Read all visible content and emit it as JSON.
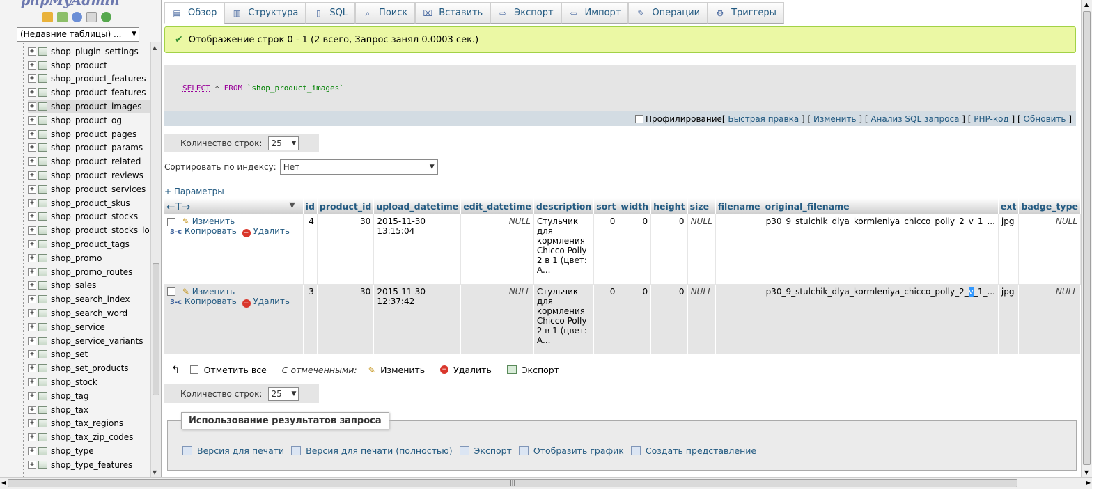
{
  "nav": {
    "logo": "phpMyAdmin",
    "recent_tables": "(Недавние таблицы) ...",
    "tables": [
      {
        "name": "shop_plugin_settings",
        "selected": false
      },
      {
        "name": "shop_product",
        "selected": false
      },
      {
        "name": "shop_product_features",
        "selected": false
      },
      {
        "name": "shop_product_features_",
        "selected": false
      },
      {
        "name": "shop_product_images",
        "selected": true
      },
      {
        "name": "shop_product_og",
        "selected": false
      },
      {
        "name": "shop_product_pages",
        "selected": false
      },
      {
        "name": "shop_product_params",
        "selected": false
      },
      {
        "name": "shop_product_related",
        "selected": false
      },
      {
        "name": "shop_product_reviews",
        "selected": false
      },
      {
        "name": "shop_product_services",
        "selected": false
      },
      {
        "name": "shop_product_skus",
        "selected": false
      },
      {
        "name": "shop_product_stocks",
        "selected": false
      },
      {
        "name": "shop_product_stocks_lo",
        "selected": false
      },
      {
        "name": "shop_product_tags",
        "selected": false
      },
      {
        "name": "shop_promo",
        "selected": false
      },
      {
        "name": "shop_promo_routes",
        "selected": false
      },
      {
        "name": "shop_sales",
        "selected": false
      },
      {
        "name": "shop_search_index",
        "selected": false
      },
      {
        "name": "shop_search_word",
        "selected": false
      },
      {
        "name": "shop_service",
        "selected": false
      },
      {
        "name": "shop_service_variants",
        "selected": false
      },
      {
        "name": "shop_set",
        "selected": false
      },
      {
        "name": "shop_set_products",
        "selected": false
      },
      {
        "name": "shop_stock",
        "selected": false
      },
      {
        "name": "shop_tag",
        "selected": false
      },
      {
        "name": "shop_tax",
        "selected": false
      },
      {
        "name": "shop_tax_regions",
        "selected": false
      },
      {
        "name": "shop_tax_zip_codes",
        "selected": false
      },
      {
        "name": "shop_type",
        "selected": false
      },
      {
        "name": "shop_type_features",
        "selected": false
      }
    ]
  },
  "tabs": [
    {
      "label": "Обзор",
      "icon": "browse-icon",
      "glyph": "▤",
      "active": true
    },
    {
      "label": "Структура",
      "icon": "structure-icon",
      "glyph": "▥",
      "active": false
    },
    {
      "label": "SQL",
      "icon": "sql-icon",
      "glyph": "▯",
      "active": false
    },
    {
      "label": "Поиск",
      "icon": "search-icon",
      "glyph": "⌕",
      "active": false
    },
    {
      "label": "Вставить",
      "icon": "insert-icon",
      "glyph": "⌧",
      "active": false
    },
    {
      "label": "Экспорт",
      "icon": "export-icon",
      "glyph": "⇨",
      "active": false
    },
    {
      "label": "Импорт",
      "icon": "import-icon",
      "glyph": "⇦",
      "active": false
    },
    {
      "label": "Операции",
      "icon": "operations-icon",
      "glyph": "✎",
      "active": false
    },
    {
      "label": "Триггеры",
      "icon": "triggers-icon",
      "glyph": "⚙",
      "active": false
    }
  ],
  "message": "Отображение строк 0 - 1 (2 всего, Запрос занял 0.0003 сек.)",
  "sql": {
    "kw_select": "SELECT",
    "star": " * ",
    "kw_from": "FROM",
    "table": " `shop_product_images`"
  },
  "sqlbar": {
    "profiling": "Профилирование",
    "links": [
      "Быстрая правка",
      "Изменить",
      "Анализ SQL запроса",
      "PHP-код",
      "Обновить"
    ]
  },
  "rows_count": {
    "label": "Количество строк:",
    "value": "25"
  },
  "sort": {
    "label": "Сортировать по индексу:",
    "value": "Нет"
  },
  "params_link": "+ Параметры",
  "table": {
    "arrows": "←T→",
    "columns": [
      "id",
      "product_id",
      "upload_datetime",
      "edit_datetime",
      "description",
      "sort",
      "width",
      "height",
      "size",
      "filename",
      "original_filename",
      "ext",
      "badge_type"
    ],
    "actions": {
      "edit": "Изменить",
      "copy": "Копировать",
      "delete": "Удалить"
    },
    "rows": [
      {
        "id": "4",
        "product_id": "30",
        "upload_datetime": "2015-11-30 13:15:04",
        "edit_datetime": "NULL",
        "description": "Стульчик для кормления Chicco Polly 2 в 1 (цвет: А...",
        "sort": "0",
        "width": "0",
        "height": "0",
        "size": "NULL",
        "filename": "",
        "original_filename": "p30_9_stulchik_dlya_kormleniya_chicco_polly_2_v_1_...",
        "ext": "jpg",
        "badge_type": "NULL"
      },
      {
        "id": "3",
        "product_id": "30",
        "upload_datetime": "2015-11-30 12:37:42",
        "edit_datetime": "NULL",
        "description": "Стульчик для кормления Chicco Polly 2 в 1 (цвет: А...",
        "sort": "0",
        "width": "0",
        "height": "0",
        "size": "NULL",
        "filename": "",
        "of_pre": "p30_9_stulchik_dlya_kormleniya_chicco_polly_2_",
        "of_hl": "v",
        "of_post": "_1_...",
        "ext": "jpg",
        "badge_type": "NULL"
      }
    ]
  },
  "with_selected": {
    "check_all": "Отметить все",
    "label": "С отмеченными:",
    "edit": "Изменить",
    "delete": "Удалить",
    "export": "Экспорт"
  },
  "query_results": {
    "legend": "Использование результатов запроса",
    "links": [
      {
        "label": "Версия для печати",
        "icon": "print-icon"
      },
      {
        "label": "Версия для печати (полностью)",
        "icon": "print-full-icon"
      },
      {
        "label": "Экспорт",
        "icon": "export-icon"
      },
      {
        "label": "Отобразить график",
        "icon": "chart-icon"
      },
      {
        "label": "Создать представление",
        "icon": "create-view-icon"
      }
    ]
  },
  "colors": {
    "link": "#235a81",
    "success_bg": "#ebf8a4",
    "sql_keyword": "#990099"
  }
}
